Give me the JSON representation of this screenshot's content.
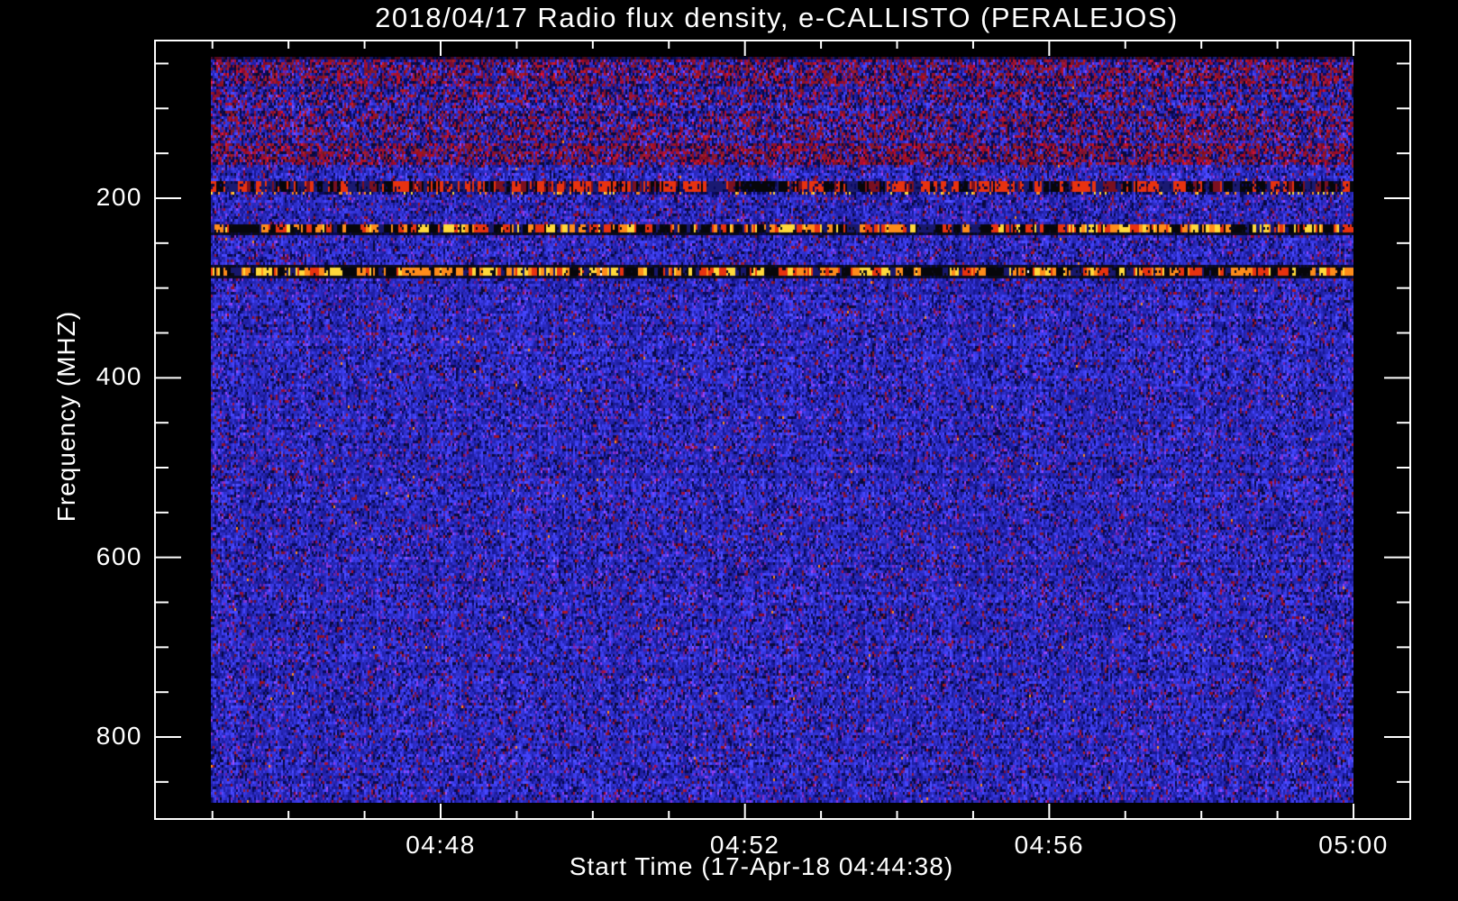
{
  "title": "2018/04/17  Radio flux density, e-CALLISTO (PERALEJOS)",
  "chart_data": {
    "type": "heatmap",
    "title": "2018/04/17  Radio flux density, e-CALLISTO (PERALEJOS)",
    "xlabel": "Start Time (17-Apr-18 04:44:38)",
    "ylabel": "Frequency (MHZ)",
    "x_axis": {
      "major_ticks": [
        {
          "label": "04:48",
          "minute": 48
        },
        {
          "label": "04:52",
          "minute": 52
        },
        {
          "label": "04:56",
          "minute": 56
        },
        {
          "label": "05:00",
          "minute": 60
        }
      ],
      "minor_tick_first_min": 45,
      "minor_tick_last_min": 60,
      "minor_tick_every_min": 1
    },
    "y_axis": {
      "major_ticks": [
        200,
        400,
        600,
        800
      ],
      "minor_tick_interval": 50,
      "minor_tick_first": 50,
      "minor_tick_last": 850,
      "direction": "frequency-increases-downward"
    },
    "data_extent": {
      "time_start": "04:44:59",
      "time_end": "05:00:00",
      "freq_top_mhz": 42.5,
      "freq_bottom_mhz": 873
    },
    "broadband_noise_region_mhz": [
      43,
      165
    ],
    "bands": [
      {
        "freq_range_mhz": [
          43,
          76
        ],
        "type": "broadband-noise",
        "intensity": 0.4
      },
      {
        "freq_range_mhz": [
          79,
          98
        ],
        "type": "broadband-noise",
        "intensity": 0.28
      },
      {
        "freq_range_mhz": [
          104,
          137
        ],
        "type": "broadband-noise",
        "intensity": 0.33
      },
      {
        "freq_range_mhz": [
          140,
          162
        ],
        "type": "broadband-noise",
        "intensity": 0.48
      },
      {
        "freq_range_mhz": [
          180,
          192
        ],
        "type": "rfi-red-dashes"
      },
      {
        "freq_range_mhz": [
          192,
          196
        ],
        "type": "rfi-orange-dots"
      },
      {
        "freq_range_mhz": [
          228,
          241
        ],
        "type": "rfi-bright-dashes"
      },
      {
        "freq_range_mhz": [
          275,
          288
        ],
        "type": "rfi-brightest-dashes"
      }
    ],
    "colors": {
      "background": "#000000",
      "axis": "#ffffff",
      "text": "#ffffff",
      "noise_blue": "#2a2ad8",
      "noise_dark": "#0a0a3c",
      "noise_red": "#8c1e3c",
      "noise_purple": "#5a28b4",
      "rfi_yellow": "#ffd93a",
      "rfi_orange": "#ff8c1a",
      "rfi_red": "#e8320f",
      "rfi_black": "#06060a",
      "rfi_white": "#ffffff"
    },
    "legend": "none",
    "grid": "off"
  }
}
